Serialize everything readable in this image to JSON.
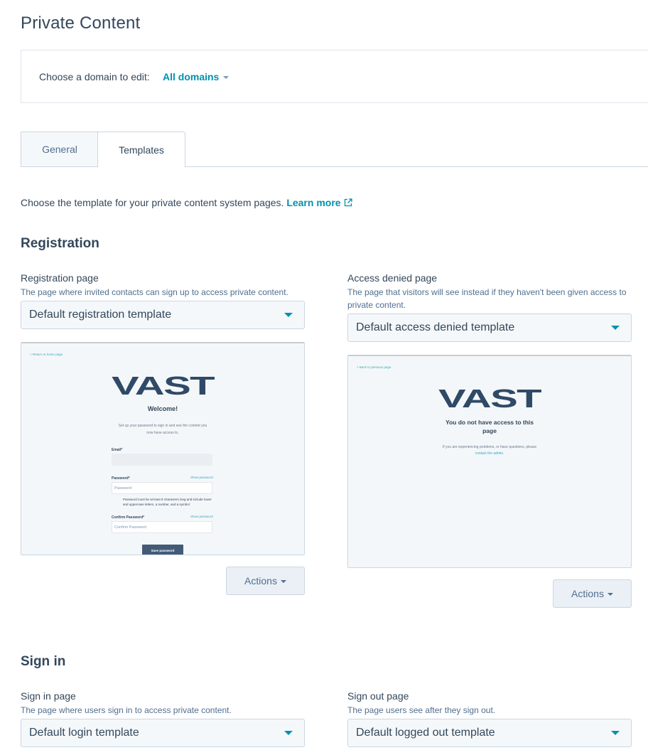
{
  "page": {
    "title": "Private Content"
  },
  "domain": {
    "label": "Choose a domain to edit:",
    "selected": "All domains"
  },
  "tabs": [
    {
      "label": "General",
      "active": false
    },
    {
      "label": "Templates",
      "active": true
    }
  ],
  "intro": {
    "text": "Choose the template for your private content system pages.",
    "link": "Learn more",
    "link_icon": "external-link-icon"
  },
  "colors": {
    "accent": "#0091ae",
    "text": "#33475b",
    "muted": "#516f90",
    "border": "#cbd6e2",
    "button_bg": "#eaf0f6"
  },
  "sections": {
    "registration": {
      "title": "Registration",
      "registration_page": {
        "label": "Registration page",
        "help": "The page where invited contacts can sign up to access private content.",
        "selected": "Default registration template",
        "actions": "Actions",
        "preview": {
          "back_link": "< Return to home page",
          "logo": "VAST",
          "heading": "Welcome!",
          "text_line1": "Set up your password to sign in and see the content you",
          "text_line2": "now have access to.",
          "email_label": "Email*",
          "password_label": "Password*",
          "show_password": "Show password",
          "password_placeholder": "Password",
          "password_note": "Password must be at least 8 characters long and include lower and uppercase letters, a number, and a symbol",
          "confirm_label": "Confirm Password*",
          "confirm_placeholder": "Confirm Password",
          "save_button": "Save password"
        }
      },
      "access_denied_page": {
        "label": "Access denied page",
        "help": "The page that visitors will see instead if they haven't been given access to private content.",
        "selected": "Default access denied template",
        "actions": "Actions",
        "preview": {
          "back_link": "< Back to previous page",
          "logo": "VAST",
          "heading": "You do not have access to this page",
          "text": "If you are experiencing problems, or have questions, please",
          "contact_link": "contact the admin."
        }
      }
    },
    "sign_in": {
      "title": "Sign in",
      "sign_in_page": {
        "label": "Sign in page",
        "help": "The page where users sign in to access private content.",
        "selected": "Default login template"
      },
      "sign_out_page": {
        "label": "Sign out page",
        "help": "The page users see after they sign out.",
        "selected": "Default logged out template"
      }
    }
  }
}
